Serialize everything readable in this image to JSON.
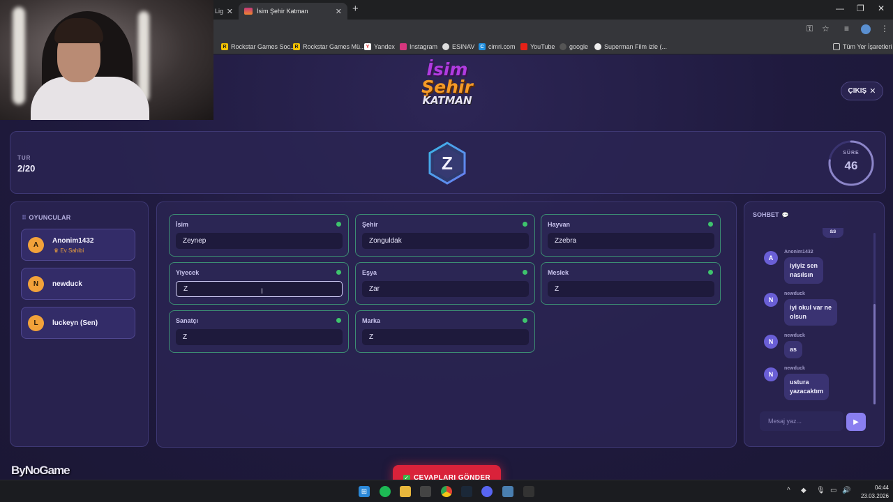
{
  "browser": {
    "tab_partial_label": "Lig",
    "tab_title": "İsim Şehir Katman",
    "bookmarks": [
      "Rockstar Games Soc...",
      "Rockstar Games Mü...",
      "Yandex",
      "Instagram",
      "ESINAV",
      "cimri.com",
      "YouTube",
      "google",
      "Superman Film izle (..."
    ],
    "bookmarks_all": "Tüm Yer İşaretleri"
  },
  "game": {
    "logo": {
      "line1": "İsim",
      "line2": "Şehir",
      "line3": "KATMAN"
    },
    "exit_label": "ÇIKIŞ",
    "round_label": "TUR",
    "round_value": "2/20",
    "letter": "Z",
    "timer_label": "SÜRE",
    "timer_value": "46",
    "timer_fraction": 0.77
  },
  "players": {
    "title": "OYUNCULAR",
    "list": [
      {
        "initial": "A",
        "name": "Anonim1432",
        "role": "Ev Sahibi"
      },
      {
        "initial": "N",
        "name": "newduck",
        "role": ""
      },
      {
        "initial": "L",
        "name": "luckeyn (Sen)",
        "role": ""
      }
    ]
  },
  "answers": {
    "fields": [
      {
        "label": "İsim",
        "value": "Zeynep"
      },
      {
        "label": "Şehir",
        "value": "Zonguldak"
      },
      {
        "label": "Hayvan",
        "value": "Zzebra"
      },
      {
        "label": "Yiyecek",
        "value": "Z"
      },
      {
        "label": "Eşya",
        "value": "Zar"
      },
      {
        "label": "Meslek",
        "value": "Z"
      },
      {
        "label": "Sanatçı",
        "value": "Z"
      },
      {
        "label": "Marka",
        "value": "Z"
      }
    ],
    "submit_label": "CEVAPLARI GÖNDER"
  },
  "chat": {
    "title": "SOHBET",
    "partial_message": "as",
    "messages": [
      {
        "initial": "A",
        "user": "Anonim1432",
        "line1": "iyiyiz sen",
        "line2": "nasılsın"
      },
      {
        "initial": "N",
        "user": "newduck",
        "line1": "iyi okul var ne",
        "line2": "olsun"
      },
      {
        "initial": "N",
        "user": "newduck",
        "line1": "as",
        "line2": ""
      },
      {
        "initial": "N",
        "user": "newduck",
        "line1": "ustura",
        "line2": "yazacaktım"
      }
    ],
    "input_placeholder": "Mesaj yaz..."
  },
  "watermark": "ByNoGame",
  "taskbar": {
    "time": "04:44",
    "date": "23.03.2026"
  },
  "colors": {
    "accent": "#8a7ff0",
    "submit": "#d9223a",
    "field_border": "#3c8e73",
    "status_ok": "#3ec46d",
    "host": "#f2a23a"
  }
}
